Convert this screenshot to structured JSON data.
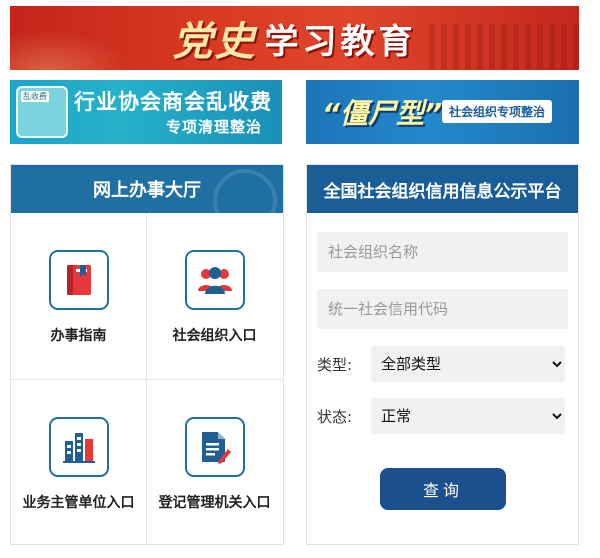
{
  "banner_top": {
    "title_a": "党史",
    "title_b": "学习教育"
  },
  "banner_left": {
    "tag": "乱收费",
    "line1": "行业协会商会乱收费",
    "line2": "专项清理整治"
  },
  "banner_right": {
    "big": "“僵尸型”",
    "pill": "社会组织专项整治"
  },
  "online_hall": {
    "title": "网上办事大厅",
    "tiles": [
      {
        "label": "办事指南",
        "icon": "book-icon"
      },
      {
        "label": "社会组织入口",
        "icon": "people-icon"
      },
      {
        "label": "业务主管单位入口",
        "icon": "building-icon"
      },
      {
        "label": "登记管理机关入口",
        "icon": "document-edit-icon"
      }
    ]
  },
  "credit_platform": {
    "title": "全国社会组织信用信息公示平台",
    "name_placeholder": "社会组织名称",
    "code_placeholder": "统一社会信用代码",
    "type_label": "类型:",
    "type_value": "全部类型",
    "status_label": "状态:",
    "status_value": "正常",
    "query_label": "查询"
  },
  "colors": {
    "accent": "#1f6fa3",
    "header_right": "#1b5d96",
    "button": "#1b4f8e",
    "banner_red": "#d83a22",
    "icon_red": "#e5393a"
  }
}
